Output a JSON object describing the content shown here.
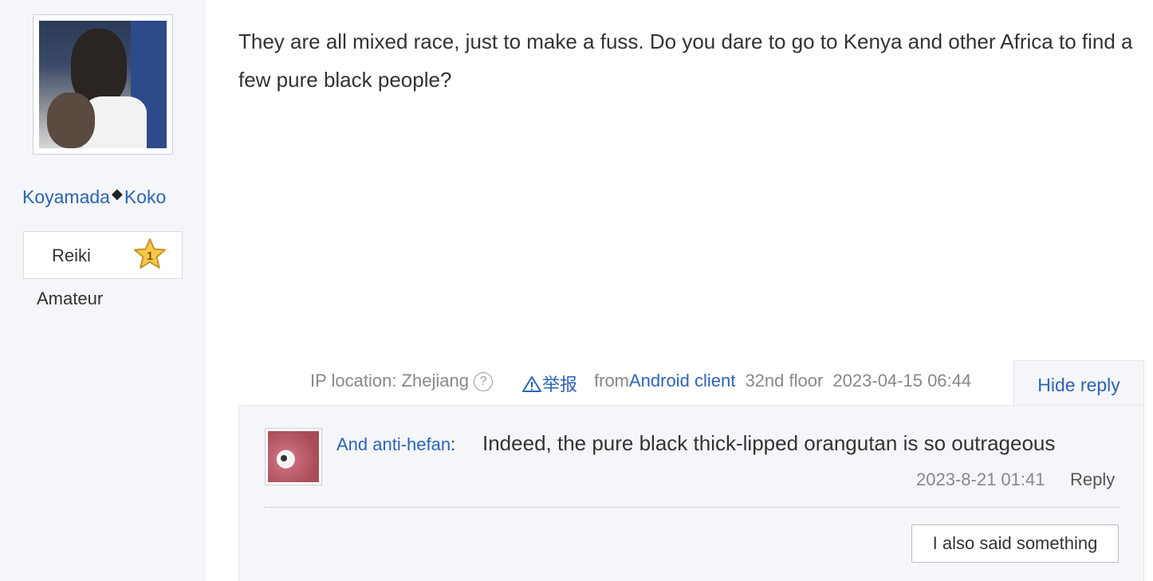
{
  "author": {
    "name_part1": "Koyamada",
    "separator": "◆",
    "name_part2": "Koko",
    "level_name": "Reiki",
    "level_number": "1",
    "rank": "Amateur"
  },
  "post": {
    "text": "They are all mixed race, just to make a fuss. Do you dare to go to Kenya and other Africa to find a few pure black people?",
    "ip_label": "IP location: Zhejiang",
    "help_icon": "?",
    "report_label": "举报",
    "from_label": "from",
    "client": "Android client",
    "floor": "32nd floor",
    "timestamp": "2023-04-15 06:44",
    "hide_reply": "Hide reply"
  },
  "reply": {
    "user": "And anti-hefan",
    "colon": ":",
    "text": "Indeed, the pure black thick-lipped orangutan is so outrageous",
    "time": "2023-8-21 01:41",
    "reply_label": "Reply",
    "say_button": "I also said something"
  },
  "colors": {
    "link": "#2d64b3",
    "sidebar_bg": "#f4f6f9",
    "meta_gray": "#888888",
    "star_fill": "#f7c948"
  }
}
